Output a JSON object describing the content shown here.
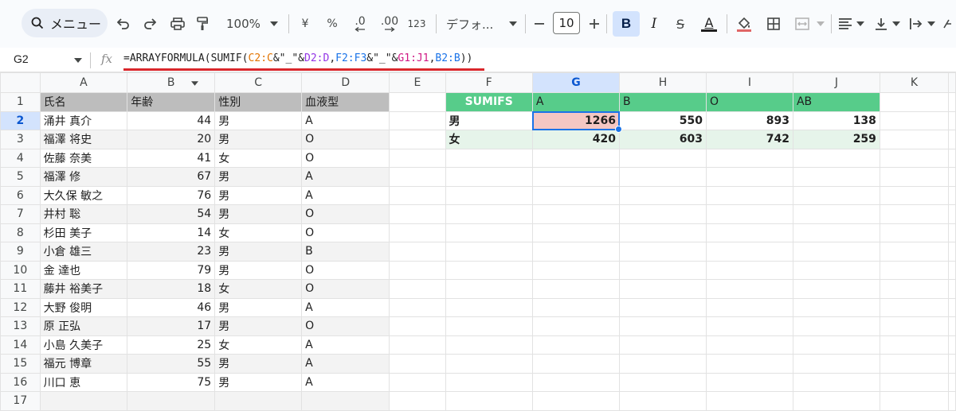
{
  "toolbar": {
    "search_label": "メニュー",
    "zoom": "100%",
    "currency": "¥",
    "percent": "%",
    "decimal_decrease": ".0",
    "decimal_increase": ".00",
    "number_format": "123",
    "font_family": "デフォ...",
    "font_size": "10",
    "bold": "B",
    "italic": "I",
    "strike": "S",
    "text_color": "A"
  },
  "formula_bar": {
    "cell_ref": "G2",
    "fx": "fx",
    "formula": {
      "p1": "=ARRAYFORMULA(SUMIF(",
      "r1": "C2:C",
      "p2": "&\"_\"&",
      "r2": "D2:D",
      "p3": ",",
      "r3": "F2:F3",
      "p4": "&\"_\"&",
      "r4": "G1:J1",
      "p5": ",",
      "r5": "B2:B",
      "p6": "))"
    }
  },
  "columns": [
    "A",
    "B",
    "C",
    "D",
    "E",
    "F",
    "G",
    "H",
    "I",
    "J",
    "K"
  ],
  "left_table": {
    "headers": [
      "氏名",
      "年齢",
      "性別",
      "血液型"
    ],
    "rows": [
      [
        "涌井 真介",
        "44",
        "男",
        "A"
      ],
      [
        "福澤 将史",
        "20",
        "男",
        "O"
      ],
      [
        "佐藤 奈美",
        "41",
        "女",
        "O"
      ],
      [
        "福澤 修",
        "67",
        "男",
        "A"
      ],
      [
        "大久保 敏之",
        "76",
        "男",
        "A"
      ],
      [
        "井村 聡",
        "54",
        "男",
        "O"
      ],
      [
        "杉田 美子",
        "14",
        "女",
        "O"
      ],
      [
        "小倉 雄三",
        "23",
        "男",
        "B"
      ],
      [
        "金 達也",
        "79",
        "男",
        "O"
      ],
      [
        "藤井 裕美子",
        "18",
        "女",
        "O"
      ],
      [
        "大野 俊明",
        "46",
        "男",
        "A"
      ],
      [
        "原 正弘",
        "17",
        "男",
        "O"
      ],
      [
        "小島 久美子",
        "25",
        "女",
        "A"
      ],
      [
        "福元 博章",
        "55",
        "男",
        "A"
      ],
      [
        "川口 恵",
        "75",
        "男",
        "A"
      ]
    ]
  },
  "summary_table": {
    "corner": "SUMIFS",
    "blood_types": [
      "A",
      "B",
      "O",
      "AB"
    ],
    "rows": [
      {
        "label": "男",
        "values": [
          "1266",
          "550",
          "893",
          "138"
        ]
      },
      {
        "label": "女",
        "values": [
          "420",
          "603",
          "742",
          "259"
        ]
      }
    ]
  },
  "row_numbers": [
    "1",
    "2",
    "3",
    "4",
    "5",
    "6",
    "7",
    "8",
    "9",
    "10",
    "11",
    "12",
    "13",
    "14",
    "15",
    "16",
    "17"
  ],
  "colors": {
    "header_gray": "#bdbdbd",
    "summary_green": "#57cc8a",
    "selected_pink": "#f4c7c3",
    "light_green": "#e6f4ea",
    "ref_orange": "#e37400",
    "ref_purple": "#9334e6",
    "ref_blue": "#1a73e8",
    "ref_pink": "#d01884",
    "underline_red": "#d9262b"
  }
}
